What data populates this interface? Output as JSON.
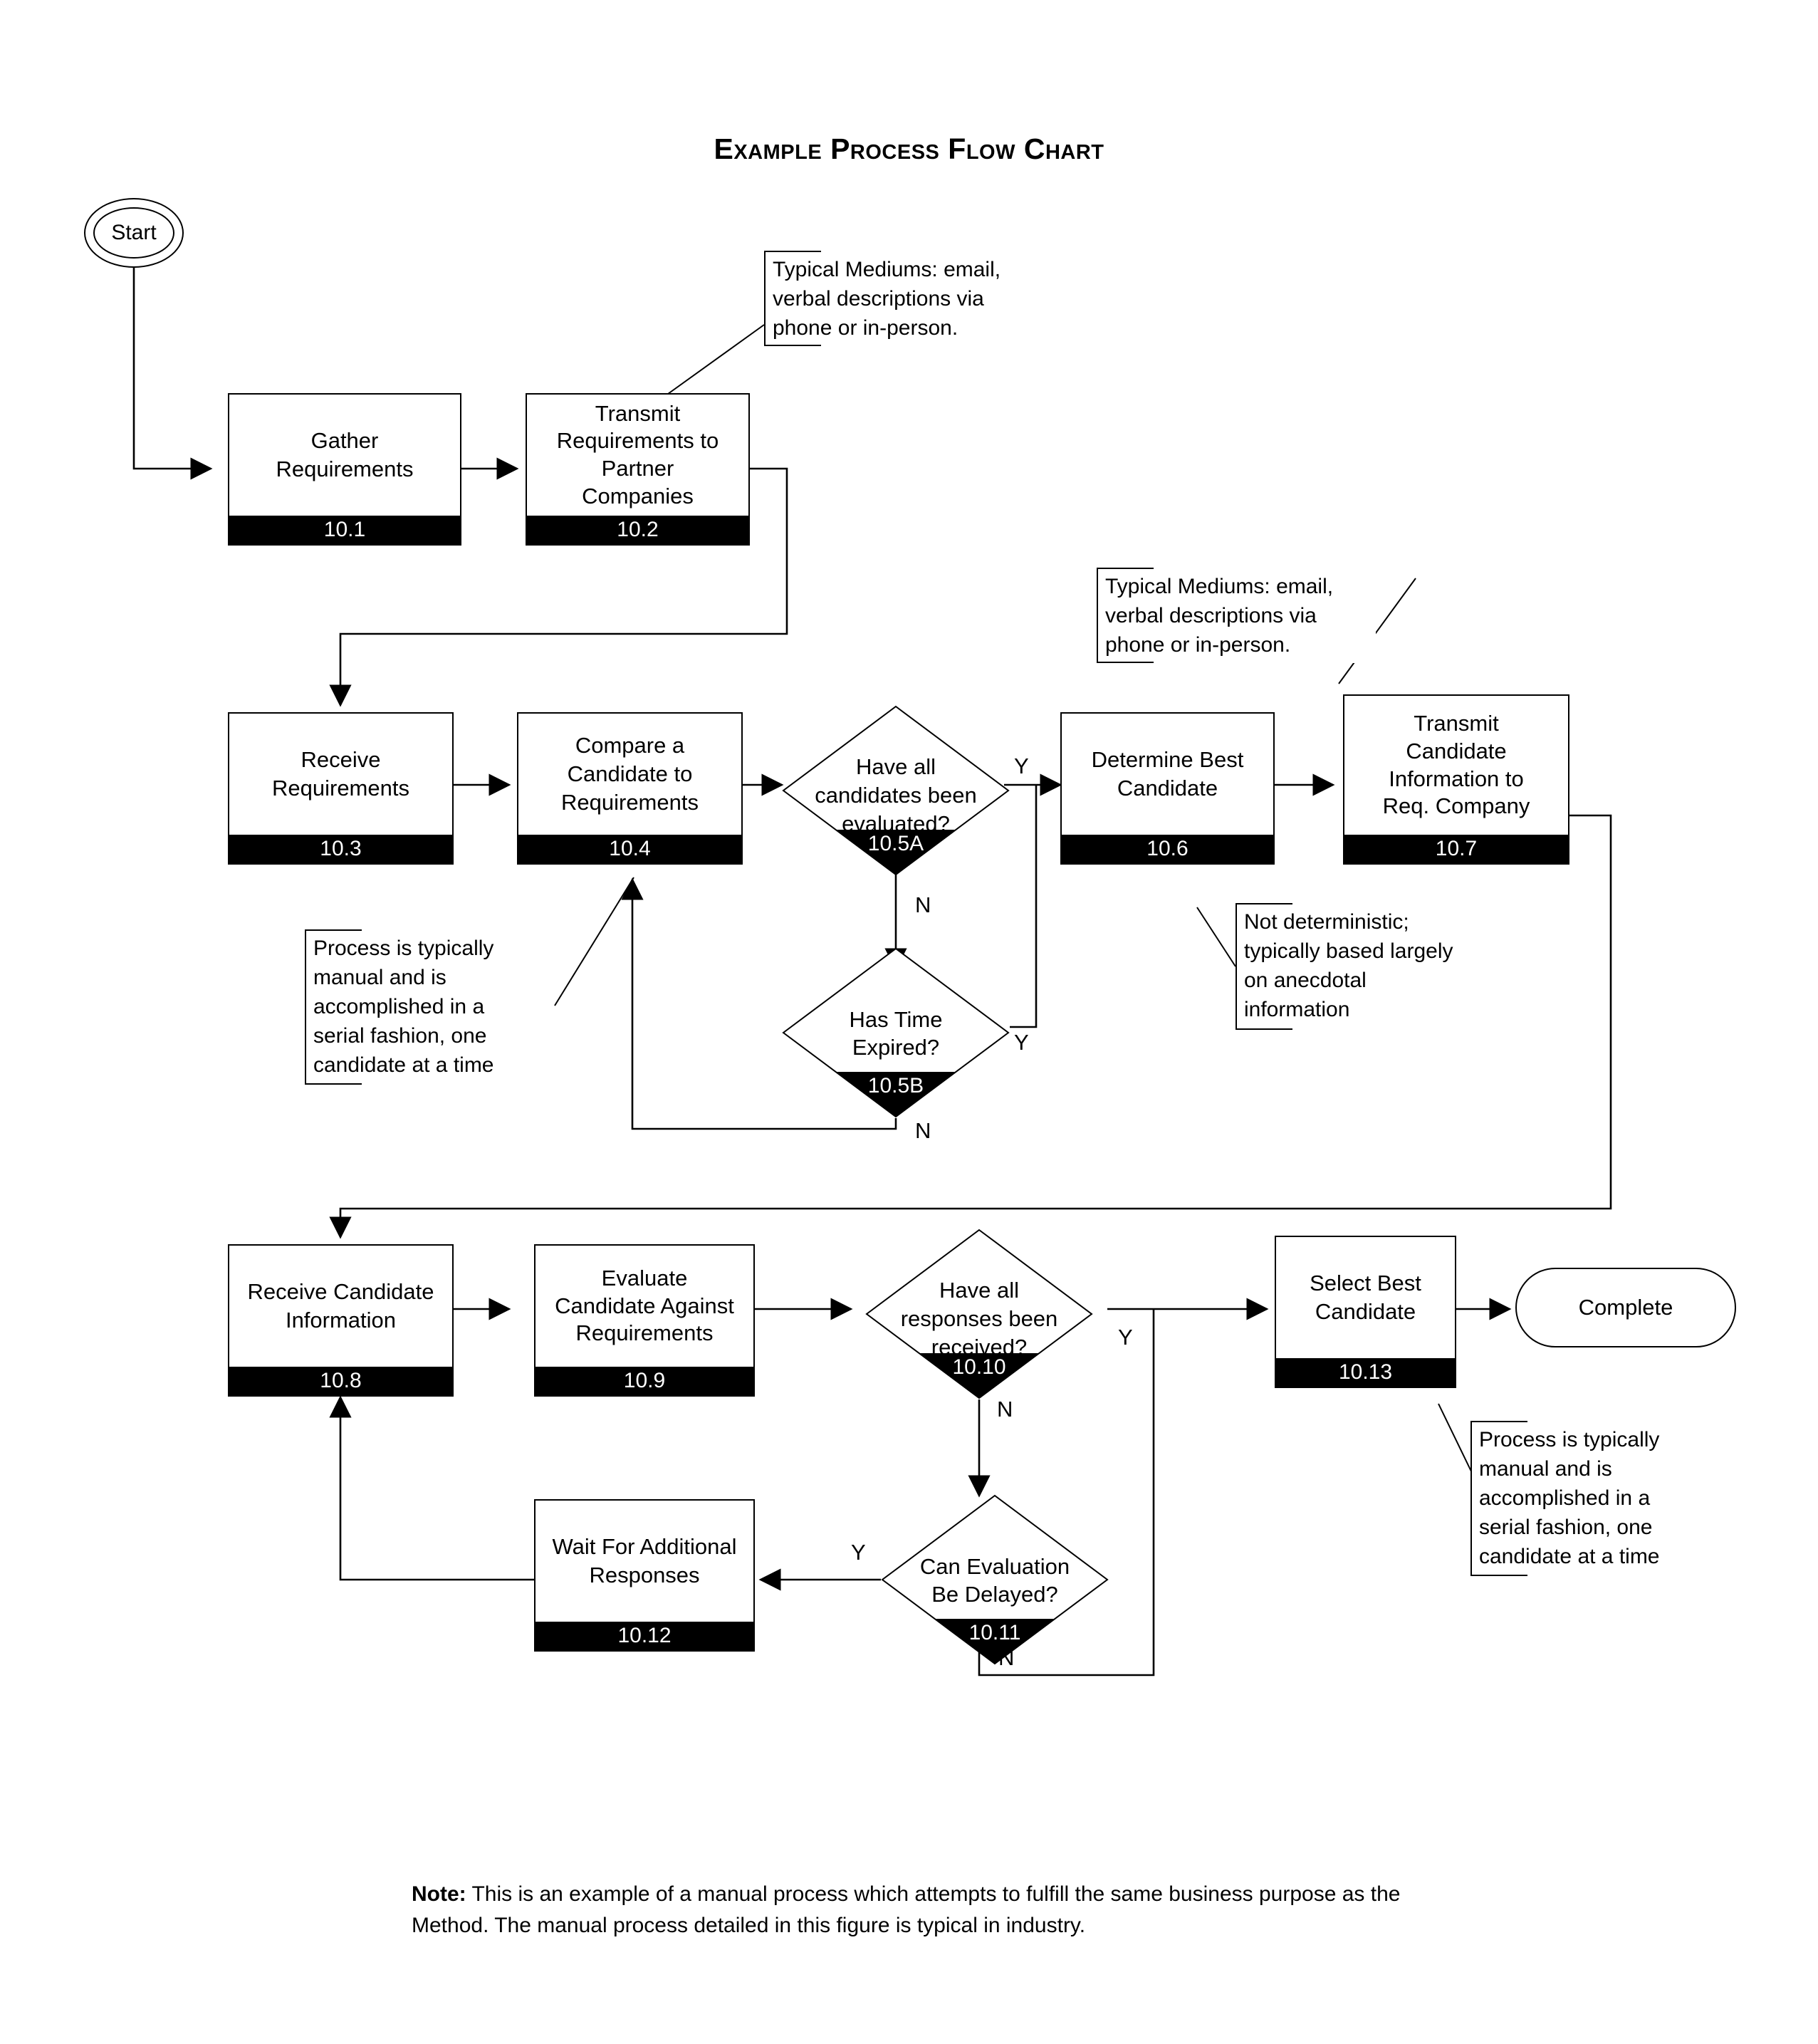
{
  "title": "Example Process Flow Chart",
  "terminators": {
    "start": "Start",
    "end": "Complete"
  },
  "branch_labels": {
    "d105a_yes": "Y",
    "d105a_no": "N",
    "d105b_yes": "Y",
    "d105b_no": "N",
    "d1010_yes": "Y",
    "d1010_no": "N",
    "d1011_yes": "Y",
    "d1011_no": "N"
  },
  "nodes": [
    {
      "id": "10.1",
      "label": "Gather\nRequirements",
      "number": "10.1",
      "shape": "process"
    },
    {
      "id": "10.2",
      "label": "Transmit\nRequirements to\nPartner\nCompanies",
      "number": "10.2",
      "shape": "process"
    },
    {
      "id": "10.3",
      "label": "Receive\nRequirements",
      "number": "10.3",
      "shape": "process"
    },
    {
      "id": "10.4",
      "label": "Compare a\nCandidate to\nRequirements",
      "number": "10.4",
      "shape": "process"
    },
    {
      "id": "10.5A",
      "label": "Have all\ncandidates been\nevaluated?",
      "number": "10.5A",
      "shape": "decision"
    },
    {
      "id": "10.5B",
      "label": "Has Time\nExpired?",
      "number": "10.5B",
      "shape": "decision"
    },
    {
      "id": "10.6",
      "label": "Determine Best\nCandidate",
      "number": "10.6",
      "shape": "process"
    },
    {
      "id": "10.7",
      "label": "Transmit\nCandidate\nInformation to\nReq. Company",
      "number": "10.7",
      "shape": "process"
    },
    {
      "id": "10.8",
      "label": "Receive Candidate\nInformation",
      "number": "10.8",
      "shape": "process"
    },
    {
      "id": "10.9",
      "label": "Evaluate\nCandidate Against\nRequirements",
      "number": "10.9",
      "shape": "process"
    },
    {
      "id": "10.10",
      "label": "Have all\nresponses been\nreceived?",
      "number": "10.10",
      "shape": "decision"
    },
    {
      "id": "10.11",
      "label": "Can Evaluation\nBe Delayed?",
      "number": "10.11",
      "shape": "decision"
    },
    {
      "id": "10.12",
      "label": "Wait For Additional\nResponses",
      "number": "10.12",
      "shape": "process"
    },
    {
      "id": "10.13",
      "label": "Select Best\nCandidate",
      "number": "10.13",
      "shape": "process"
    }
  ],
  "node_text": {
    "n101_l1": "Gather",
    "n101_l2": "Requirements",
    "n102_l1": "Transmit",
    "n102_l2": "Requirements to",
    "n102_l3": "Partner",
    "n102_l4": "Companies",
    "n103_l1": "Receive",
    "n103_l2": "Requirements",
    "n104_l1": "Compare a",
    "n104_l2": "Candidate to",
    "n104_l3": "Requirements",
    "n105a_l1": "Have all",
    "n105a_l2": "candidates been",
    "n105a_l3": "evaluated?",
    "n105b_l1": "Has Time",
    "n105b_l2": "Expired?",
    "n106_l1": "Determine Best",
    "n106_l2": "Candidate",
    "n107_l1": "Transmit",
    "n107_l2": "Candidate",
    "n107_l3": "Information to",
    "n107_l4": "Req. Company",
    "n108_l1": "Receive Candidate",
    "n108_l2": "Information",
    "n109_l1": "Evaluate",
    "n109_l2": "Candidate Against",
    "n109_l3": "Requirements",
    "n1010_l1": "Have all",
    "n1010_l2": "responses been",
    "n1010_l3": "received?",
    "n1011_l1": "Can Evaluation",
    "n1011_l2": "Be Delayed?",
    "n1012_l1": "Wait For Additional",
    "n1012_l2": "Responses",
    "n1013_l1": "Select Best",
    "n1013_l2": "Candidate"
  },
  "node_numbers": {
    "n101": "10.1",
    "n102": "10.2",
    "n103": "10.3",
    "n104": "10.4",
    "n105a": "10.5A",
    "n105b": "10.5B",
    "n106": "10.6",
    "n107": "10.7",
    "n108": "10.8",
    "n109": "10.9",
    "n1010": "10.10",
    "n1011": "10.11",
    "n1012": "10.12",
    "n1013": "10.13"
  },
  "callouts": [
    {
      "id": "callout-mediums-1",
      "target": "10.2",
      "lines": [
        "Typical Mediums: email,",
        "verbal descriptions via",
        "phone or in-person."
      ]
    },
    {
      "id": "callout-mediums-2",
      "target": "10.7",
      "lines": [
        "Typical Mediums: email,",
        "verbal descriptions via",
        "phone or in-person."
      ]
    },
    {
      "id": "callout-manual-1",
      "target": "10.4",
      "lines": [
        "Process is typically",
        "manual and is",
        "accomplished in a",
        "serial fashion, one",
        "candidate at a time"
      ]
    },
    {
      "id": "callout-nondeterministic",
      "target": "10.6",
      "lines": [
        "Not deterministic;",
        "typically based largely",
        "on anecdotal",
        "information"
      ]
    },
    {
      "id": "callout-manual-2",
      "target": "10.13",
      "lines": [
        "Process is typically",
        "manual and is",
        "accomplished in a",
        "serial fashion, one",
        "candidate at a time"
      ]
    }
  ],
  "callout_text": {
    "c1_l1": "Typical Mediums: email,",
    "c1_l2": "verbal descriptions via",
    "c1_l3": "phone or in-person.",
    "c2_l1": "Typical Mediums: email,",
    "c2_l2": "verbal descriptions via",
    "c2_l3": "phone or in-person.",
    "c3_l1": "Process is typically",
    "c3_l2": "manual and is",
    "c3_l3": "accomplished in a",
    "c3_l4": "serial fashion, one",
    "c3_l5": "candidate at a time",
    "c4_l1": "Not deterministic;",
    "c4_l2": "typically based largely",
    "c4_l3": "on anecdotal",
    "c4_l4": "information",
    "c5_l1": "Process is typically",
    "c5_l2": "manual and is",
    "c5_l3": "accomplished in a",
    "c5_l4": "serial fashion, one",
    "c5_l5": "candidate at a time"
  },
  "footer": {
    "label": "Note:",
    "text": " This is an example of a manual process which attempts to fulfill the same business purpose as the Method.  The manual process detailed in this figure is typical in industry."
  },
  "colors": {
    "line": "#000000",
    "fill": "#ffffff",
    "number_bar": "#000000",
    "number_text": "#ffffff"
  }
}
